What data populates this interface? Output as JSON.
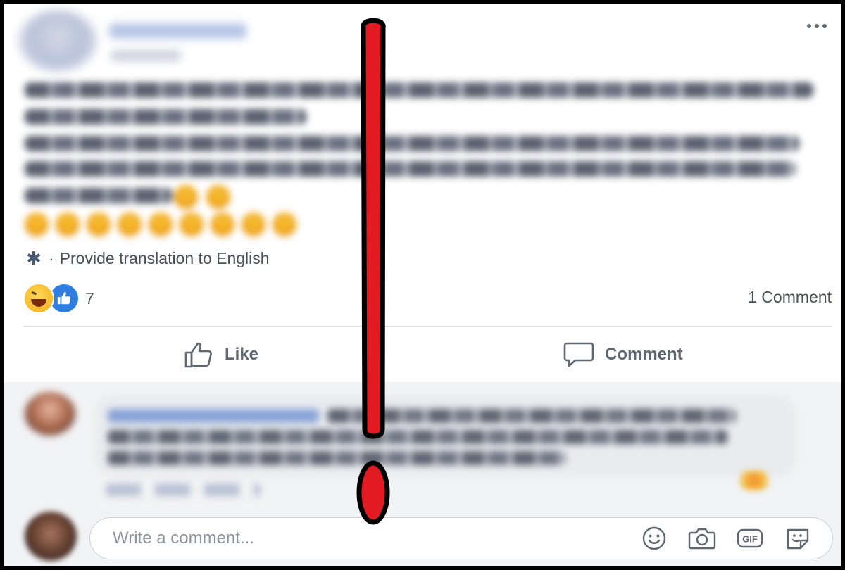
{
  "post": {
    "translate_label": "Provide translation to English",
    "translate_separator": "·",
    "reaction_count": "7",
    "comment_count": "1 Comment"
  },
  "actions": {
    "like_label": "Like",
    "comment_label": "Comment"
  },
  "composer": {
    "placeholder": "Write a comment..."
  },
  "icons": {
    "menu": "more-options-icon",
    "translate": "gear-icon",
    "like": "thumbs-up-icon",
    "comment": "speech-bubble-icon",
    "emoji": "smiley-icon",
    "photo": "camera-icon",
    "gif": "gif-icon",
    "sticker": "sticker-icon"
  },
  "colors": {
    "frame": "#000000",
    "overlay_fill": "#e21b23",
    "text": "#4b4f56",
    "like_blue": "#2f7de1"
  }
}
